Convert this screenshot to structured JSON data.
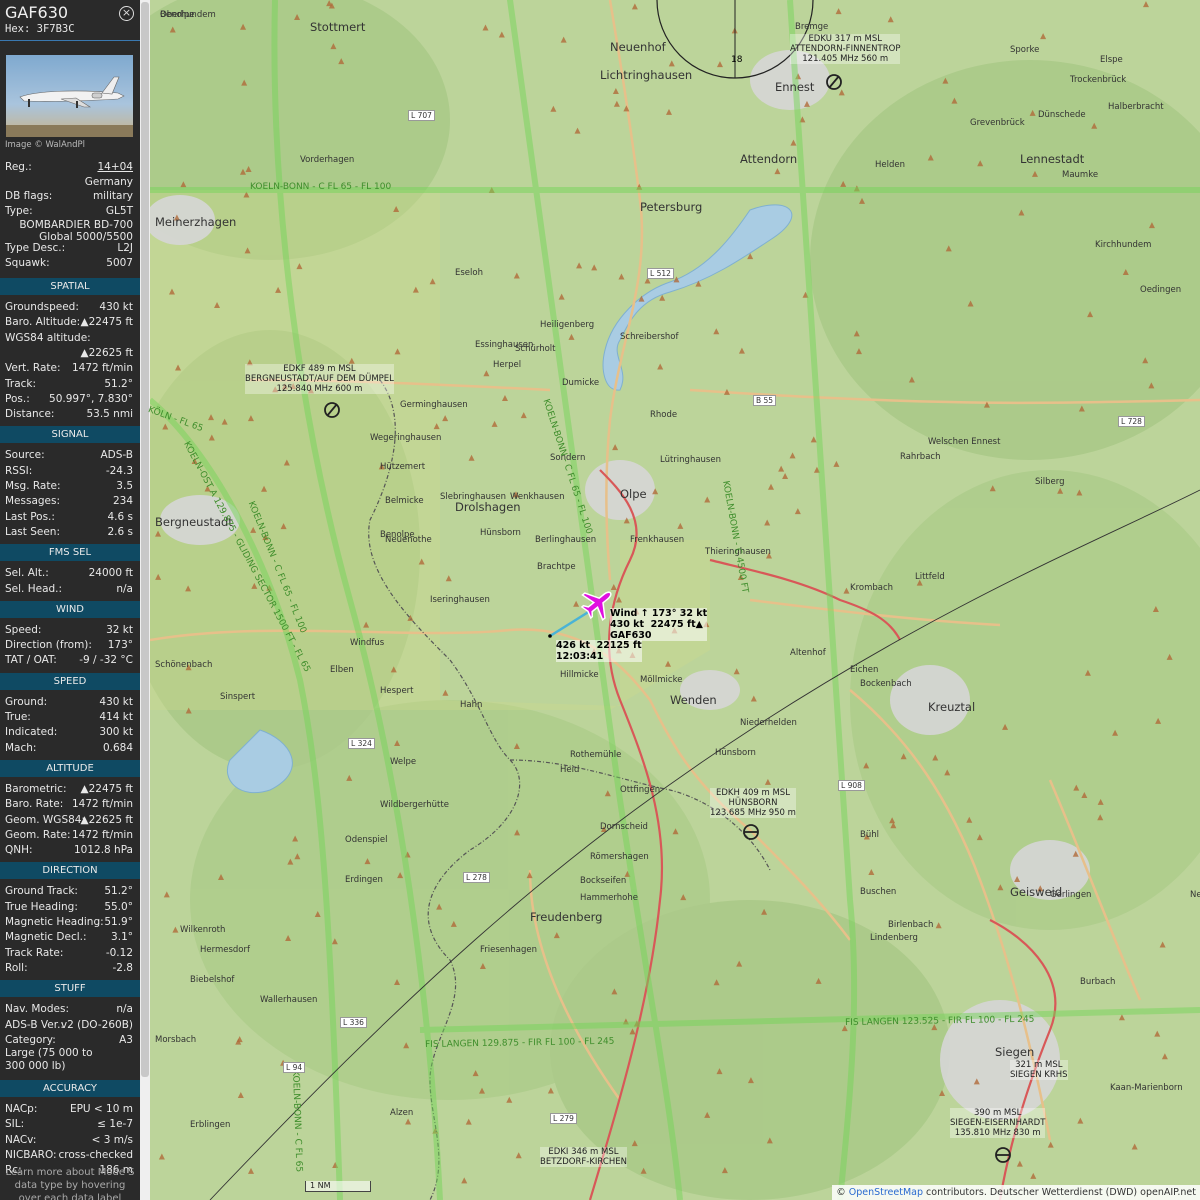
{
  "aircraft": {
    "callsign": "GAF630",
    "hex_label": "Hex:",
    "hex": "3F7B3C",
    "image_credit": "Image © WalAndPl"
  },
  "info": [
    {
      "k": "Reg.:",
      "v": "14+04",
      "link": true
    },
    {
      "k": "",
      "v": "Germany"
    },
    {
      "k": "DB flags:",
      "v": "military"
    },
    {
      "k": "Type:",
      "v": "GL5T"
    },
    {
      "k": "",
      "v": "BOMBARDIER BD-700"
    },
    {
      "k": "",
      "v": "Global 5000/5500"
    },
    {
      "k": "Type Desc.:",
      "v": "L2J"
    },
    {
      "k": "Squawk:",
      "v": "5007"
    }
  ],
  "sections": {
    "spatial": {
      "title": "SPATIAL",
      "rows": [
        {
          "k": "Groundspeed:",
          "v": "430 kt"
        },
        {
          "k": "Baro. Altitude:",
          "v": "▲22475 ft"
        },
        {
          "k": "WGS84 altitude:",
          "v": ""
        },
        {
          "k": "",
          "v": "▲22625 ft"
        },
        {
          "k": "Vert. Rate:",
          "v": "1472 ft/min"
        },
        {
          "k": "Track:",
          "v": "51.2°"
        },
        {
          "k": "Pos.:",
          "v": "50.997°, 7.830°"
        },
        {
          "k": "Distance:",
          "v": "53.5 nmi"
        }
      ]
    },
    "signal": {
      "title": "SIGNAL",
      "rows": [
        {
          "k": "Source:",
          "v": "ADS-B"
        },
        {
          "k": "RSSI:",
          "v": "-24.3"
        },
        {
          "k": "Msg. Rate:",
          "v": "3.5"
        },
        {
          "k": "Messages:",
          "v": "234"
        },
        {
          "k": "Last Pos.:",
          "v": "4.6 s"
        },
        {
          "k": "Last Seen:",
          "v": "2.6 s"
        }
      ]
    },
    "fms": {
      "title": "FMS SEL",
      "rows": [
        {
          "k": "Sel. Alt.:",
          "v": "24000 ft"
        },
        {
          "k": "Sel. Head.:",
          "v": "n/a"
        }
      ]
    },
    "wind": {
      "title": "WIND",
      "rows": [
        {
          "k": "Speed:",
          "v": "32 kt"
        },
        {
          "k": "Direction (from):",
          "v": "173°"
        },
        {
          "k": "TAT / OAT:",
          "v": "-9 / -32 °C"
        }
      ]
    },
    "speed": {
      "title": "SPEED",
      "rows": [
        {
          "k": "Ground:",
          "v": "430 kt"
        },
        {
          "k": "True:",
          "v": "414 kt"
        },
        {
          "k": "Indicated:",
          "v": "300 kt"
        },
        {
          "k": "Mach:",
          "v": "0.684"
        }
      ]
    },
    "altitude": {
      "title": "ALTITUDE",
      "rows": [
        {
          "k": "Barometric:",
          "v": "▲22475 ft"
        },
        {
          "k": "Baro. Rate:",
          "v": "1472 ft/min"
        },
        {
          "k": "Geom. WGS84:",
          "v": "▲22625 ft"
        },
        {
          "k": "Geom. Rate:",
          "v": "1472 ft/min"
        },
        {
          "k": "QNH:",
          "v": "1012.8 hPa"
        }
      ]
    },
    "direction": {
      "title": "DIRECTION",
      "rows": [
        {
          "k": "Ground Track:",
          "v": "51.2°"
        },
        {
          "k": "True Heading:",
          "v": "55.0°"
        },
        {
          "k": "Magnetic Heading:",
          "v": "51.9°"
        },
        {
          "k": "Magnetic Decl.:",
          "v": "3.1°"
        },
        {
          "k": "Track Rate:",
          "v": "-0.12"
        },
        {
          "k": "Roll:",
          "v": "-2.8"
        }
      ]
    },
    "stuff": {
      "title": "STUFF",
      "rows": [
        {
          "k": "Nav. Modes:",
          "v": "n/a"
        },
        {
          "k": "ADS-B Ver.:",
          "v": "v2 (DO-260B)"
        },
        {
          "k": "Category:",
          "v": "A3"
        }
      ],
      "category_desc_1": "Large (75 000 to",
      "category_desc_2": "300 000 lb)"
    },
    "accuracy": {
      "title": "ACCURACY",
      "rows": [
        {
          "k": "NACp:",
          "v": "EPU < 10 m"
        },
        {
          "k": "SIL:",
          "v": "≤ 1e-7"
        },
        {
          "k": "NACv:",
          "v": "< 3 m/s"
        },
        {
          "k": "NICBARO:",
          "v": "cross-checked"
        },
        {
          "k": "Rc:",
          "v": "186 m"
        }
      ]
    }
  },
  "learn_more": "Learn more about Mode S data type by hovering over each data label",
  "map": {
    "attribution_prefix": "© ",
    "attribution_osm": "OpenStreetMap",
    "attribution_rest": " contributors. Deutscher Wetterdienst (DWD) openAIP.net",
    "scale": "1 NM",
    "plane_label_1": "Wind ↑ 173° 32 kt",
    "plane_label_2": "430 kt  22475 ft▲",
    "plane_label_3": "GAF630",
    "trail_label_1": "426 kt  22125 ft",
    "trail_label_2": "12:03:41",
    "places": [
      "Stottmert",
      "Neuenhof",
      "Lichtringhausen",
      "Ennest",
      "Attendorn",
      "Lennestadt",
      "Meinerzhagen",
      "Petersburg",
      "Bergneustadt",
      "Drolshagen",
      "Olpe",
      "Kreuztal",
      "Wenden",
      "Freudenberg",
      "Geisweid",
      "Siegen",
      "Vorderhagen",
      "Eseloh",
      "Heiligenberg",
      "Dumicke",
      "Rhode",
      "Lütringhausen",
      "Thieringhausen",
      "Möllmicke",
      "Hillmicke",
      "Hünsborn",
      "Rothemühle",
      "Hammerhohe",
      "Bockenbach",
      "Eichen",
      "Littfeld",
      "Krombach",
      "Welschen Ennest",
      "Rahrbach",
      "Silberg",
      "Birlenbach",
      "Netphen",
      "Burbach",
      "Kaan-Marienborn",
      "Morsbach",
      "Friesenhagen",
      "Wildbergerhütte",
      "Hahn",
      "Hespert",
      "Schönenbach",
      "Elben",
      "Altenhof",
      "Niederhelden",
      "Helden",
      "Bremge",
      "Sporke",
      "Elspe",
      "Trockenbrück",
      "Halberbracht",
      "Maumke",
      "Grevenbrück",
      "Dünschede",
      "Oedingen",
      "Kirchhundem",
      "Benolpe",
      "Heid",
      "Ottfingen",
      "Bühl",
      "Buschen",
      "Lindenberg",
      "Dornscheid",
      "Römershagen",
      "Bockseifen",
      "Wilkenroth",
      "Hermesdorf",
      "Welpe",
      "Odenspiel",
      "Erdingen",
      "Wallerhausen",
      "Biebelshof",
      "Alzen",
      "Erblingen",
      "Sinspert",
      "Windfus",
      "Iseringhausen",
      "Brachtpe",
      "Berlinghausen",
      "Wenkhausen",
      "Slebringhausen",
      "Germinghausen",
      "Wegeringhausen",
      "Hützemert",
      "Belmicke",
      "Neuenothe",
      "Essinghausen",
      "Schürholt",
      "Herpel",
      "Schreibershof",
      "Sondern",
      "Frenkhausen",
      "Gerlingen",
      "Hünsborn",
      "Oberhundem",
      "Benolpe"
    ],
    "airfields": [
      {
        "l1": "EDKU 317 m MSL",
        "l2": "ATTENDORN-FINNENTROP",
        "l3": "121.405 MHz 560 m"
      },
      {
        "l1": "EDKF 489 m MSL",
        "l2": "BERGNEUSTADT/AUF DEM DÜMPEL",
        "l3": "125.840 MHz 600 m"
      },
      {
        "l1": "EDKH 409 m MSL",
        "l2": "HÜNSBORN",
        "l3": "123.685 MHz 950 m"
      },
      {
        "l1": "321 m MSL",
        "l2": "SIEGEN KRHS",
        "l3": ""
      },
      {
        "l1": "390 m MSL",
        "l2": "SIEGEN-EISERNHARDT",
        "l3": "135.810 MHz 830 m"
      },
      {
        "l1": "EDKI 346 m MSL",
        "l2": "BETZDORF-KIRCHEN",
        "l3": ""
      }
    ],
    "airspaces": [
      "KOELN-BONN - C FL 65 - FL 100",
      "FIS LANGEN 129.875 - FIR FL 100 - FL 245",
      "FIS LANGEN 123.525 - FIR FL 100 - FL 245",
      "KOELN-BONN - C FL 65 - FL 100",
      "KOELN-OST A 129.875 - GLIDING SECTOR 1500 FT - FL 65",
      "KOELN-BONN - C FL 65 - FL 100",
      "KOELN-BONN - C 4500 FT",
      "KOELN-BONN - C FL 65",
      "KÖLN - FL 65"
    ],
    "roads": [
      "L 707",
      "L 512",
      "B 55",
      "L 728",
      "L 324",
      "L 278",
      "L 336",
      "L 908",
      "L 279",
      "L 94"
    ]
  },
  "colors": {
    "panel": "#2a2a2a",
    "section": "#0f4a63",
    "plane": "#e010e0",
    "airspace_green": "#6fcf4f"
  }
}
